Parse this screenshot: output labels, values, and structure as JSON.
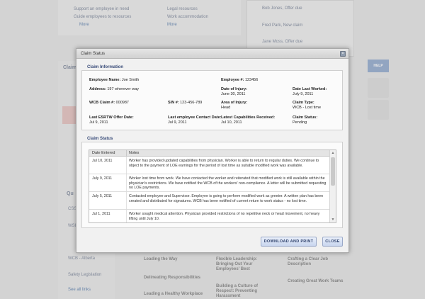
{
  "background": {
    "top_links": [
      "Support an employee in need",
      "Guide employees to resources",
      "More",
      "Legal resources",
      "Work accommodation",
      "More"
    ],
    "right_items": [
      "Bob Jones, Offer due",
      "Fred Park, New claim",
      "Jane Moss, Offer due"
    ],
    "left_labels": [
      "Claims",
      "Qu",
      "CSS",
      "WSI",
      "WCB - Alberta",
      "Safety Legislation",
      "See all links"
    ],
    "help": "HELP",
    "courses": [
      "Leading the Way",
      "Delineating Responsibilities",
      "Leading a Healthy Workplace",
      "Flexible Leadership: Bringing Out Your Employees' Best",
      "Building a Culture of Respect: Preventing Harassment",
      "Crafting a Clear Job Description",
      "Creating Great Work Teams"
    ]
  },
  "modal": {
    "title": "Claim Status",
    "close_icon": "close-icon",
    "claim_info_label": "Claim Information",
    "claim_status_label": "Claim Status",
    "fields": {
      "employee_name_label": "Employee Name:",
      "employee_name": "Joe Smith",
      "employee_num_label": "Employee #:",
      "employee_num": "123456",
      "address_label": "Address:",
      "address": "197 wherever way",
      "date_of_injury_label": "Date of Injury:",
      "date_of_injury": "June 30, 2011",
      "date_last_worked_label": "Date Last Worked:",
      "date_last_worked": "July 9, 2011",
      "wcb_claim_label": "WCB Claim #:",
      "wcb_claim": "000987",
      "sin_label": "SIN #:",
      "sin": "123-456-789",
      "area_of_injury_label": "Area of Injury:",
      "area_of_injury": "Head",
      "claim_type_label": "Claim Type:",
      "claim_type": "WCB - Lost time",
      "last_esrtw_label": "Last ESRTW Offer Date:",
      "last_esrtw": "Jul 9, 2011",
      "last_contact_label": "Last employee Contact Date:",
      "last_contact": "Jul 9, 2011",
      "latest_capabilities_label": "Latest Capabilities Received:",
      "latest_capabilities": "Jul 10, 2011",
      "claim_status_field_label": "Claim Status:",
      "claim_status_field": "Pending"
    },
    "table": {
      "headers": [
        "Date Entered",
        "Notes"
      ],
      "rows": [
        {
          "date": "Jul 10, 2011",
          "note": "Worker has provided updated capabilities from physician. Worker is able to return to regular duties. We continue to object to the payment of LOE earnings for the period of lost time as suitable modified work was available."
        },
        {
          "date": "July 9, 2011",
          "note": "Worker lost time from work. We have contacted the worker and reiterated that modified work is still available within the physician's restrictions. We have notified the WCB of the workers' non-compliance. A letter will be submitted requesting no LOE payments."
        },
        {
          "date": "July 5, 2011",
          "note": "Contacted employee and Supervisor. Employee is going to perform modified work as greeter. A written plan has been created and distributed for signatures. WCB has been notified of current return to work status - no lost time."
        },
        {
          "date": "Jul 1, 2011",
          "note": "Worker sought medical attention. Physician provided restrictions of no repetitive neck or head movement, no heavy lifting until July 10."
        }
      ]
    },
    "buttons": {
      "download": "DOWNLOAD AND PRINT",
      "close": "CLOSE"
    }
  }
}
